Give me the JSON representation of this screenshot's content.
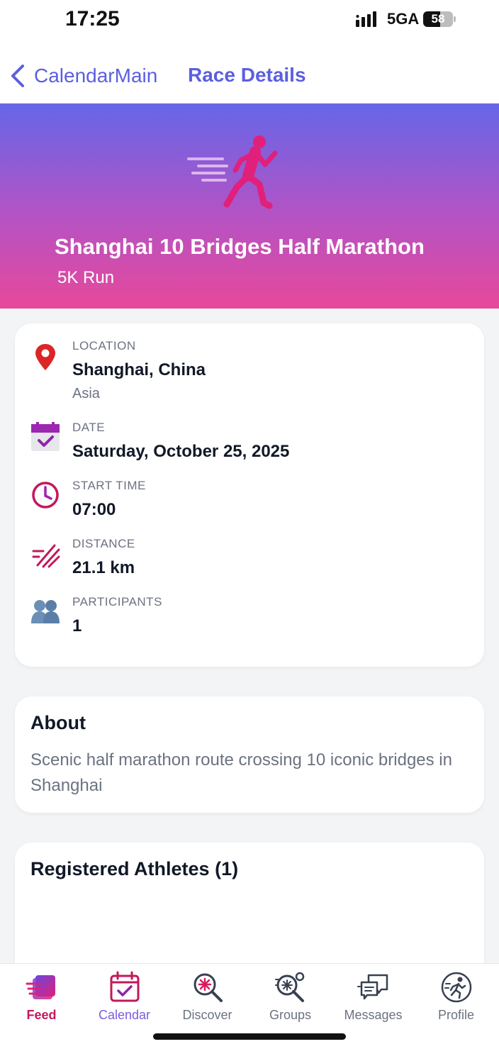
{
  "status_bar": {
    "time": "17:25",
    "network": "5GA",
    "battery": "58",
    "battery_level": 0.58
  },
  "nav": {
    "back_label": "CalendarMain",
    "title": "Race Details"
  },
  "hero": {
    "icon": "runner-icon",
    "title": "Shanghai 10 Bridges Half Marathon",
    "subtitle": "5K Run"
  },
  "details": {
    "location": {
      "icon": "location-pin-icon",
      "label": "LOCATION",
      "value": "Shanghai, China",
      "sub": "Asia"
    },
    "date": {
      "icon": "calendar-check-icon",
      "label": "DATE",
      "value": "Saturday, October 25, 2025"
    },
    "start_time": {
      "icon": "clock-icon",
      "label": "START TIME",
      "value": "07:00"
    },
    "distance": {
      "icon": "speed-lines-icon",
      "label": "DISTANCE",
      "value": "21.1 km"
    },
    "participants": {
      "icon": "people-icon",
      "label": "PARTICIPANTS",
      "value": "1"
    }
  },
  "about": {
    "heading": "About",
    "text": "Scenic half marathon route crossing 10 iconic bridges in Shanghai"
  },
  "athletes": {
    "heading": "Registered Athletes (1)"
  },
  "tabs": [
    {
      "label": "Feed",
      "icon": "feed-icon"
    },
    {
      "label": "Calendar",
      "icon": "calendar-icon"
    },
    {
      "label": "Discover",
      "icon": "discover-icon"
    },
    {
      "label": "Groups",
      "icon": "groups-icon"
    },
    {
      "label": "Messages",
      "icon": "messages-icon"
    },
    {
      "label": "Profile",
      "icon": "profile-icon"
    }
  ],
  "colors": {
    "accent": "#5b5fe0",
    "hero_top": "#6566e8",
    "hero_bottom": "#e7489a",
    "runner": "#e0207a",
    "feed_active": "#c2185b"
  }
}
